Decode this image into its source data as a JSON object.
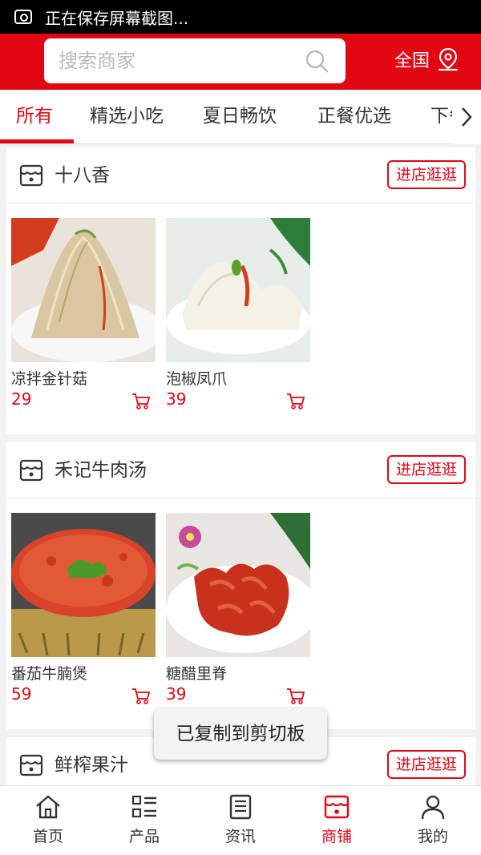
{
  "status_bar": {
    "text": "正在保存屏幕截图..."
  },
  "header": {
    "search_placeholder": "搜索商家",
    "region_label": "全国"
  },
  "tabs": [
    {
      "label": "所有",
      "active": true
    },
    {
      "label": "精选小吃"
    },
    {
      "label": "夏日畅饮"
    },
    {
      "label": "正餐优选"
    },
    {
      "label": "下午"
    }
  ],
  "stores": [
    {
      "name": "十八香",
      "enter_label": "进店逛逛",
      "products": [
        {
          "name": "凉拌金针菇",
          "price": "29"
        },
        {
          "name": "泡椒凤爪",
          "price": "39"
        }
      ]
    },
    {
      "name": "禾记牛肉汤",
      "enter_label": "进店逛逛",
      "products": [
        {
          "name": "番茄牛腩煲",
          "price": "59"
        },
        {
          "name": "糖醋里脊",
          "price": "39"
        }
      ]
    },
    {
      "name": "鲜榨果汁",
      "enter_label": "进店逛逛",
      "products": []
    }
  ],
  "toast": {
    "text": "已复制到剪切板"
  },
  "bottom_nav": [
    {
      "label": "首页"
    },
    {
      "label": "产品"
    },
    {
      "label": "资讯"
    },
    {
      "label": "商铺",
      "active": true
    },
    {
      "label": "我的"
    }
  ],
  "colors": {
    "accent": "#e30613",
    "background": "#f2f2f2"
  }
}
